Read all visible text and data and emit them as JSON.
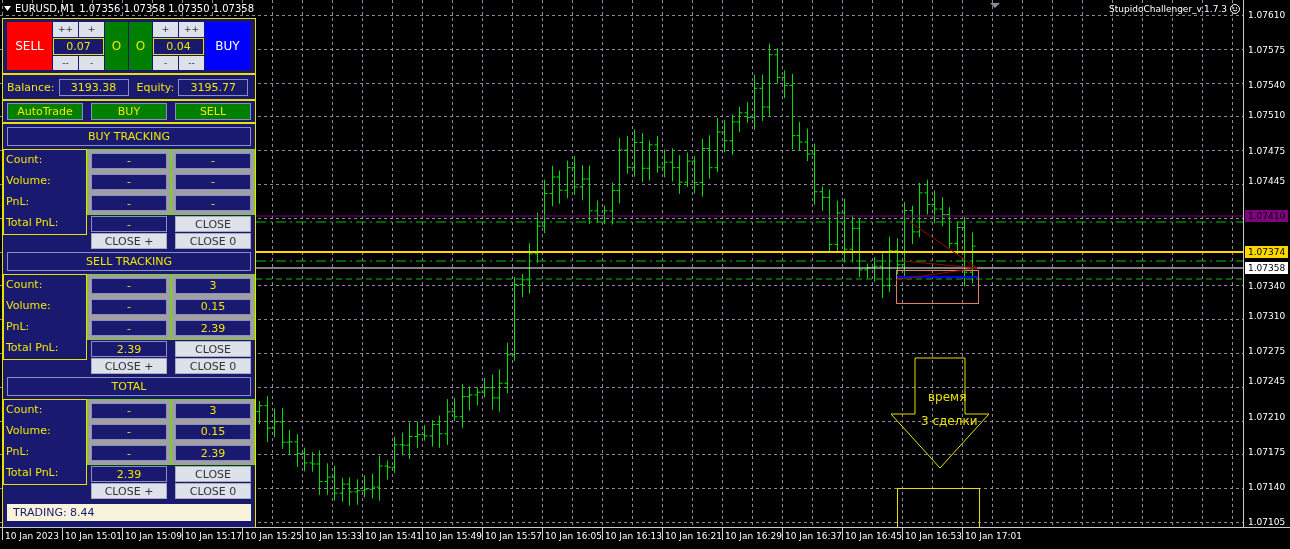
{
  "chart": {
    "title": "EURUSD,M1",
    "quote": "1.07356 1.07358 1.07350 1.07358",
    "expert": "StupidoChallenger_v.1.7.3",
    "price_axis": [
      "1.07610",
      "1.07575",
      "1.07540",
      "1.07510",
      "1.07475",
      "1.07445",
      "1.07340",
      "1.07310",
      "1.07275",
      "1.07245",
      "1.07210",
      "1.07175",
      "1.07140",
      "1.07105"
    ],
    "price_tags": [
      {
        "label": "1.07410",
        "color": "#800080"
      },
      {
        "label": "1.07374",
        "color": "#ffd700"
      },
      {
        "label": "1.07358",
        "color": "#ffffff"
      }
    ],
    "time_axis": [
      "10 Jan 2023",
      "10 Jan 15:01",
      "10 Jan 15:09",
      "10 Jan 15:17",
      "10 Jan 15:25",
      "10 Jan 15:33",
      "10 Jan 15:41",
      "10 Jan 15:49",
      "10 Jan 15:57",
      "10 Jan 16:05",
      "10 Jan 16:13",
      "10 Jan 16:21",
      "10 Jan 16:29",
      "10 Jan 16:37",
      "10 Jan 16:45",
      "10 Jan 16:53",
      "10 Jan 17:01"
    ],
    "arrow_label": [
      "время",
      "3 сделки"
    ]
  },
  "panel": {
    "sell_button": "SELL",
    "buy_button": "BUY",
    "lots": [
      {
        "up": [
          "++",
          "+"
        ],
        "value": "0.07",
        "down": [
          "--",
          "-"
        ]
      },
      {
        "up": [
          "+",
          "++"
        ],
        "value": "0.04",
        "down": [
          "-",
          "--"
        ]
      }
    ],
    "middle_buttons": [
      "O",
      "O"
    ],
    "balance_label": "Balance:",
    "balance": "3193.38",
    "equity_label": "Equity:",
    "equity": "3195.77",
    "mode_buttons": [
      "AutoTrade",
      "BUY",
      "SELL"
    ],
    "sections": [
      {
        "title": "BUY TRACKING",
        "labels": [
          "Count:",
          "Volume:",
          "PnL:",
          "Total PnL:"
        ],
        "rows": [
          [
            "-",
            "-"
          ],
          [
            "-",
            "-"
          ],
          [
            "-",
            "-"
          ]
        ],
        "total": "-",
        "close": "CLOSE",
        "close_plus": "CLOSE +",
        "close_zero": "CLOSE 0"
      },
      {
        "title": "SELL TRACKING",
        "labels": [
          "Count:",
          "Volume:",
          "PnL:",
          "Total PnL:"
        ],
        "rows": [
          [
            "-",
            "3"
          ],
          [
            "-",
            "0.15"
          ],
          [
            "-",
            "2.39"
          ]
        ],
        "total": "2.39",
        "close": "CLOSE",
        "close_plus": "CLOSE +",
        "close_zero": "CLOSE 0"
      },
      {
        "title": "TOTAL",
        "labels": [
          "Count:",
          "Volume:",
          "PnL:",
          "Total PnL:"
        ],
        "rows": [
          [
            "-",
            "3"
          ],
          [
            "-",
            "0.15"
          ],
          [
            "-",
            "2.39"
          ]
        ],
        "total": "2.39",
        "close": "CLOSE",
        "close_plus": "CLOSE +",
        "close_zero": "CLOSE 0"
      }
    ],
    "status": "TRADING: 8.44"
  }
}
